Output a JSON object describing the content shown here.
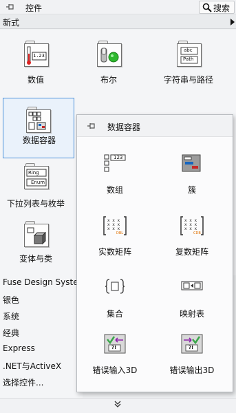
{
  "window": {
    "title": "控件",
    "search_label": "搜索"
  },
  "category": {
    "label": "新式"
  },
  "palette": {
    "items": [
      {
        "label": "数值",
        "icon": "numeric-icon"
      },
      {
        "label": "布尔",
        "icon": "boolean-icon"
      },
      {
        "label": "字符串与路径",
        "icon": "string-path-icon"
      },
      {
        "label": "数据容器",
        "icon": "data-container-icon"
      },
      {
        "label": "下拉列表与枚举",
        "icon": "ring-enum-icon"
      },
      {
        "label": "变体与类",
        "icon": "variant-class-icon"
      }
    ],
    "icon_text": {
      "numeric": "1.23",
      "string_abc": "abc",
      "string_path": "Path",
      "ring": "Ring",
      "enum": "Enum"
    }
  },
  "list": {
    "items": [
      "Fuse Design System",
      "银色",
      "系统",
      "经典",
      "Express",
      ".NET与ActiveX",
      "选择控件..."
    ]
  },
  "subpalette": {
    "title": "数据容器",
    "items": [
      {
        "label": "数组",
        "icon": "array-icon"
      },
      {
        "label": "簇",
        "icon": "cluster-icon"
      },
      {
        "label": "实数矩阵",
        "icon": "real-matrix-icon"
      },
      {
        "label": "复数矩阵",
        "icon": "complex-matrix-icon"
      },
      {
        "label": "集合",
        "icon": "set-icon"
      },
      {
        "label": "映射表",
        "icon": "map-icon"
      },
      {
        "label": "错误输入3D",
        "icon": "error-in-3d-icon"
      },
      {
        "label": "错误输出3D",
        "icon": "error-out-3d-icon"
      }
    ],
    "icon_text": {
      "array_num": "123",
      "real": "DBL",
      "complex": "CDB",
      "err": "?!"
    }
  },
  "bottom": {
    "chevron": "»"
  },
  "colors": {
    "selection_border": "#4a90d9",
    "error_green": "#3aa64a",
    "boolean_green": "#2db82d"
  }
}
